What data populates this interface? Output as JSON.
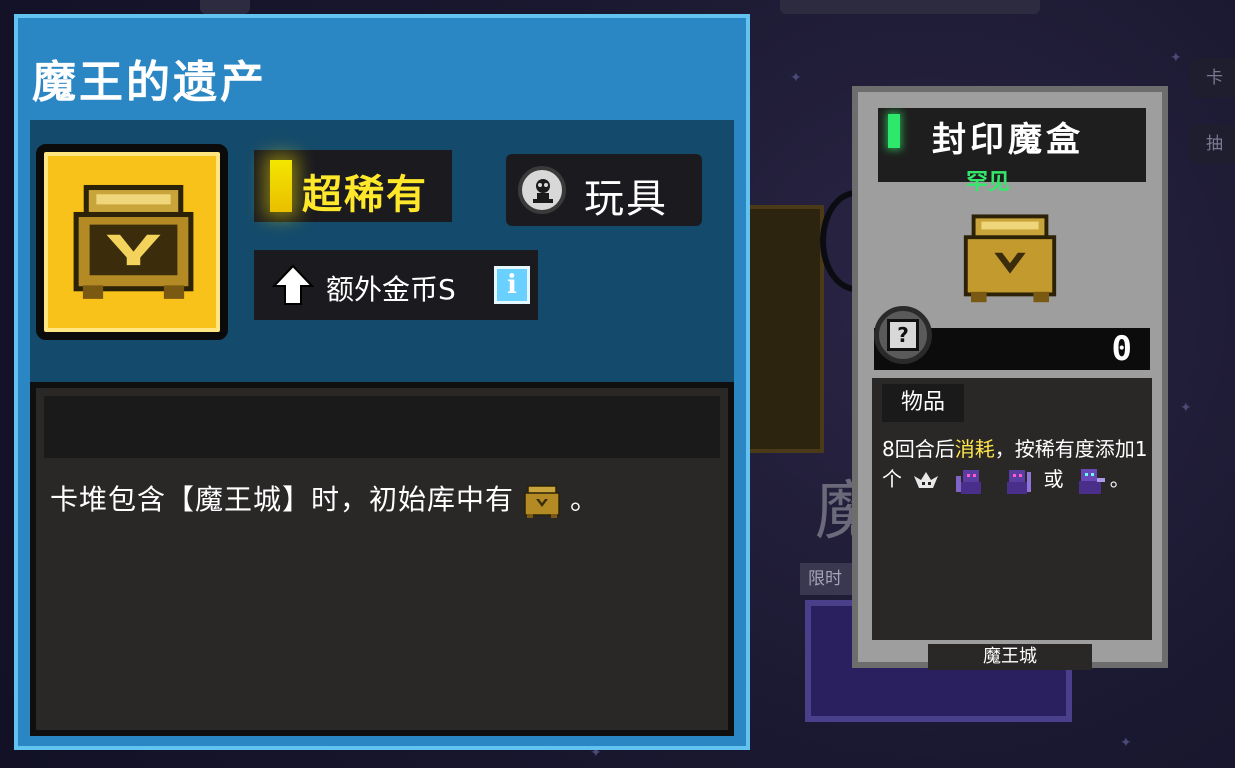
{
  "main": {
    "title": "魔王的遗产",
    "rarity_label": "超稀有",
    "type_label": "玩具",
    "bonus_label": "额外金币S",
    "info_icon_glyph": "i",
    "description_before": "卡堆包含【魔王城】时，初始库中有",
    "description_after": "。",
    "colors": {
      "panel_blue": "#2b87c3",
      "border_light_blue": "#62c3f0",
      "rarity_yellow": "#ffe82a",
      "icon_gold": "#f9c21a"
    }
  },
  "card": {
    "name": "封印魔盒",
    "rarity": "罕见",
    "cost_icon_glyph": "?",
    "cost_value": "0",
    "category": "物品",
    "text_part1": "8回合后",
    "text_highlight": "消耗",
    "text_part2": "，按稀有度添加1个",
    "text_or": "或",
    "text_end": "。",
    "footer": "魔王城",
    "colors": {
      "rarity_green": "#35e86c",
      "highlight_yellow": "#ffe74a"
    }
  },
  "background": {
    "tag_text": "限时",
    "big_char": "魔",
    "side_tab_1": "卡",
    "side_tab_2": "抽"
  },
  "icons": [
    "chest-icon",
    "toy-icon",
    "up-arrow-icon",
    "info-icon",
    "question-coin-icon",
    "goat-skull-icon",
    "demon-unit-icon"
  ]
}
